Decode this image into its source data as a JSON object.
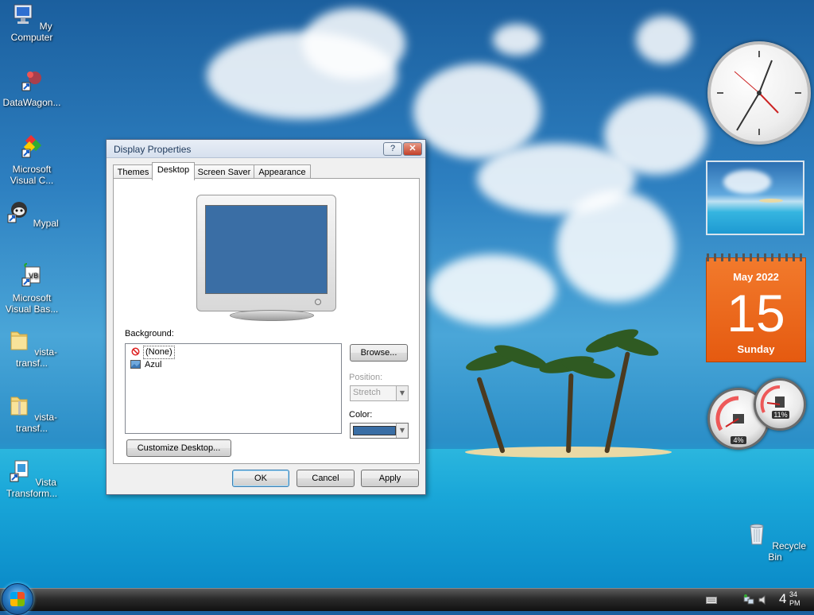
{
  "desktop": {
    "icons": [
      {
        "label": "My Computer",
        "icon": "computer-icon"
      },
      {
        "label": "DataWagon...",
        "icon": "shortcut-icon"
      },
      {
        "label": "Microsoft Visual C...",
        "icon": "visual-c-icon"
      },
      {
        "label": "Mypal",
        "icon": "browser-icon"
      },
      {
        "label": "Microsoft Visual Bas...",
        "icon": "visual-basic-icon"
      },
      {
        "label": "vista-transf...",
        "icon": "folder-icon"
      },
      {
        "label": "vista-transf...",
        "icon": "zip-folder-icon"
      },
      {
        "label": "Vista Transform...",
        "icon": "installer-icon"
      },
      {
        "label": "Recycle Bin",
        "icon": "recycle-bin-icon"
      }
    ]
  },
  "dialog": {
    "title": "Display Properties",
    "help_label": "?",
    "close_label": "✕",
    "tabs": [
      {
        "label": "Themes"
      },
      {
        "label": "Desktop"
      },
      {
        "label": "Screen Saver"
      },
      {
        "label": "Appearance"
      }
    ],
    "active_tab": "Desktop",
    "background_label": "Background:",
    "background_items": [
      {
        "label": "(None)",
        "selected": true
      },
      {
        "label": "Azul",
        "selected": false
      }
    ],
    "browse_label": "Browse...",
    "position_label": "Position:",
    "position_value": "Stretch",
    "color_label": "Color:",
    "color_value": "#3a6ea5",
    "customize_label": "Customize Desktop...",
    "ok_label": "OK",
    "cancel_label": "Cancel",
    "apply_label": "Apply"
  },
  "gadgets": {
    "calendar": {
      "month": "May 2022",
      "day": "15",
      "weekday": "Sunday"
    },
    "cpu_percent": "4%",
    "memory_percent": "11%"
  },
  "taskbar": {
    "clock_hour": "4",
    "clock_minutes": "34",
    "clock_ampm": "PM"
  }
}
